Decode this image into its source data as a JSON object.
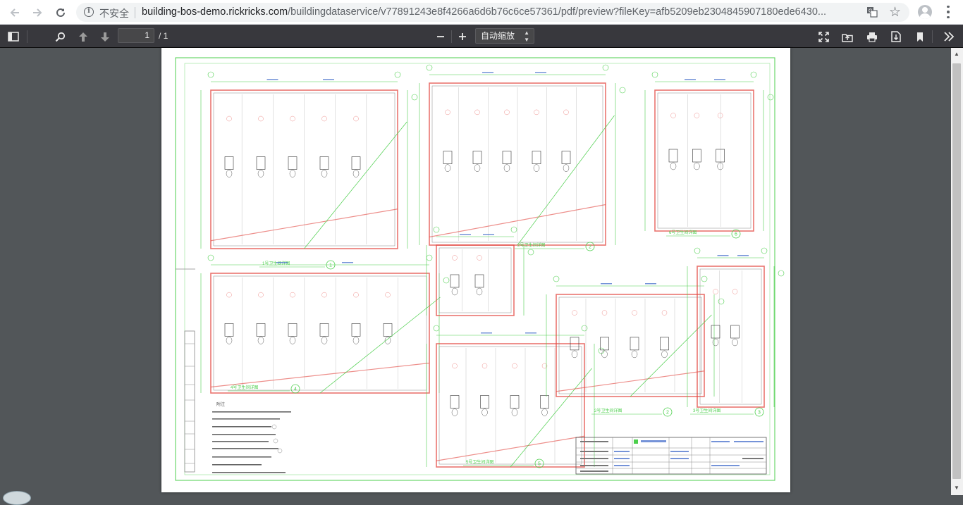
{
  "browser": {
    "back_icon": "arrow-left-icon",
    "forward_icon": "arrow-right-icon",
    "reload_icon": "reload-icon",
    "security_label": "不安全",
    "url_host": "building-bos-demo.rickricks.com",
    "url_path": "/buildingdataservice/v77891243e8f4266a6d6b76c6ce57361/pdf/preview?fileKey=afb5209eb2304845907180ede6430..."
  },
  "pdf_toolbar": {
    "page_number": "1",
    "page_total": "/ 1",
    "zoom_label": "自动缩放",
    "buttons": [
      "sidebar-toggle-icon",
      "find-icon",
      "previous-page-icon",
      "next-page-icon",
      "zoom-out-icon",
      "zoom-in-icon",
      "presentation-mode-icon",
      "open-file-icon",
      "print-icon",
      "download-icon",
      "bookmark-icon",
      "tools-icon"
    ]
  },
  "drawing": {
    "plan_titles": [
      "1号卫生间详图",
      "2号卫生间详图",
      "3号卫生间详图",
      "4号卫生间详图",
      "5号卫生间详图",
      "6号卫生间详图"
    ],
    "plan_numbers": [
      "1",
      "2",
      "3",
      "4",
      "5",
      "6"
    ],
    "notes_title": "附注"
  },
  "colors": {
    "toolbar_bg": "#38383d",
    "viewer_bg": "#525659",
    "cad_green": "#4ccf4c",
    "cad_red": "#e2453f",
    "cad_blue": "#3b66c8",
    "cad_gray": "#888888"
  }
}
